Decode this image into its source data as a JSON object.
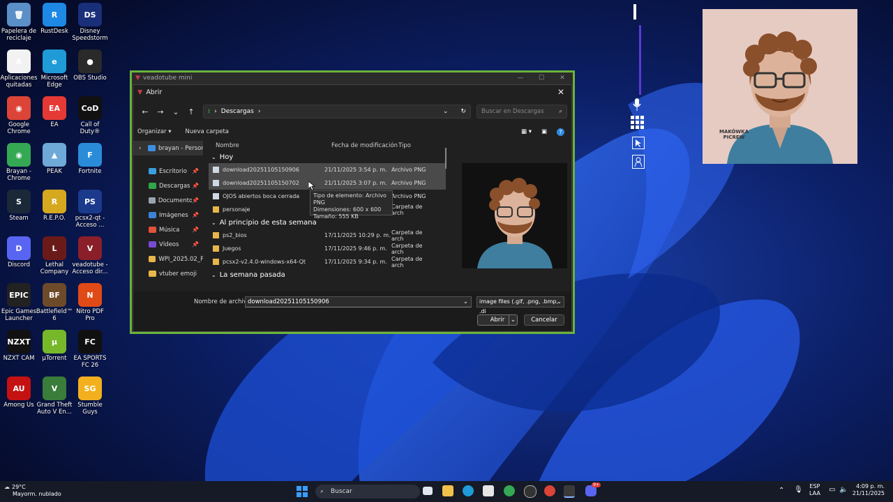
{
  "desktop": {
    "icons": [
      {
        "label": "Papelera de reciclaje",
        "color": "#5a8fc7",
        "glyph": "🗑"
      },
      {
        "label": "RustDesk",
        "color": "#1e88e5",
        "glyph": "R"
      },
      {
        "label": "Disney Speedstorm",
        "color": "#1a2f7a",
        "glyph": "DS"
      },
      {
        "label": "Aplicaciones quitadas",
        "color": "#f2f2f2",
        "glyph": "A"
      },
      {
        "label": "Microsoft Edge",
        "color": "#1f9bd7",
        "glyph": "e"
      },
      {
        "label": "OBS Studio",
        "color": "#2a2a2a",
        "glyph": "●"
      },
      {
        "label": "Google Chrome",
        "color": "#db4437",
        "glyph": "◉"
      },
      {
        "label": "EA",
        "color": "#e53935",
        "glyph": "EA"
      },
      {
        "label": "Call of Duty®",
        "color": "#111111",
        "glyph": "CoD"
      },
      {
        "label": "Brayan - Chrome",
        "color": "#34a853",
        "glyph": "◉"
      },
      {
        "label": "PEAK",
        "color": "#6ea9d8",
        "glyph": "▲"
      },
      {
        "label": "Fortnite",
        "color": "#2a8cd8",
        "glyph": "F"
      },
      {
        "label": "Steam",
        "color": "#1b2838",
        "glyph": "S"
      },
      {
        "label": "R.E.P.O.",
        "color": "#d6a820",
        "glyph": "R"
      },
      {
        "label": "pcsx2-qt - Acceso ...",
        "color": "#1b3a8c",
        "glyph": "PS"
      },
      {
        "label": "Discord",
        "color": "#5865f2",
        "glyph": "D"
      },
      {
        "label": "Lethal Company",
        "color": "#6b1a1a",
        "glyph": "L"
      },
      {
        "label": "veadotube - Acceso dir...",
        "color": "#8a1f2a",
        "glyph": "V"
      },
      {
        "label": "Epic Games Launcher",
        "color": "#222222",
        "glyph": "EPIC"
      },
      {
        "label": "Battlefield™ 6",
        "color": "#6d4a2a",
        "glyph": "BF"
      },
      {
        "label": "Nitro PDF Pro",
        "color": "#e04a16",
        "glyph": "N"
      },
      {
        "label": "NZXT CAM",
        "color": "#111111",
        "glyph": "NZXT"
      },
      {
        "label": "µTorrent",
        "color": "#77b82a",
        "glyph": "µ"
      },
      {
        "label": "EA SPORTS FC 26",
        "color": "#101010",
        "glyph": "FC"
      },
      {
        "label": "Among Us",
        "color": "#c51111",
        "glyph": "AU"
      },
      {
        "label": "Grand Theft Auto V En...",
        "color": "#3a7d3a",
        "glyph": "V"
      },
      {
        "label": "Stumble Guys",
        "color": "#f2b01e",
        "glyph": "SG"
      }
    ]
  },
  "vt_window": {
    "title": "veadotube mini"
  },
  "dialog": {
    "title": "Abrir",
    "breadcrumb": "Descargas",
    "search_placeholder": "Buscar en Descargas",
    "organize": "Organizar",
    "new_folder": "Nueva carpeta",
    "nav": [
      {
        "label": "brayan - Person",
        "color": "#3b8fe0"
      },
      {
        "label": "Escritorio",
        "color": "#3b9ee0"
      },
      {
        "label": "Descargas",
        "color": "#2fa64a"
      },
      {
        "label": "Documentos",
        "color": "#9aa4b0"
      },
      {
        "label": "Imágenes",
        "color": "#3a84d6"
      },
      {
        "label": "Música",
        "color": "#e0523b"
      },
      {
        "label": "Vídeos",
        "color": "#7a4ad6"
      },
      {
        "label": "WPI_2025.02_Pl",
        "color": "#e8b64a"
      },
      {
        "label": "vtuber emoji",
        "color": "#e8b64a"
      }
    ],
    "columns": {
      "name": "Nombre",
      "date": "Fecha de modificación",
      "type": "Tipo"
    },
    "groups": [
      {
        "label": "Hoy",
        "rows": [
          {
            "name": "download20251105150906",
            "date": "21/11/2025 3:54 p. m.",
            "type": "Archivo PNG",
            "kind": "file",
            "selected": true
          },
          {
            "name": "download20251105150702",
            "date": "21/11/2025 3:07 p. m.",
            "type": "Archivo PNG",
            "kind": "file",
            "selected": true
          },
          {
            "name": "OJOS abiertos boca cerrada",
            "date": "",
            "type": "Archivo PNG",
            "kind": "file",
            "selected": false
          },
          {
            "name": "personaje",
            "date": "",
            "type": "Carpeta de arch",
            "kind": "folder",
            "selected": false
          }
        ]
      },
      {
        "label": "Al principio de esta semana",
        "rows": [
          {
            "name": "ps2_bios",
            "date": "17/11/2025 10:29 p. m.",
            "type": "Carpeta de arch",
            "kind": "folder",
            "selected": false
          },
          {
            "name": "Juegos",
            "date": "17/11/2025 9:46 p. m.",
            "type": "Carpeta de arch",
            "kind": "folder",
            "selected": false
          },
          {
            "name": "pcsx2-v2.4.0-windows-x64-Qt",
            "date": "17/11/2025 9:34 p. m.",
            "type": "Carpeta de arch",
            "kind": "folder",
            "selected": false
          }
        ]
      },
      {
        "label": "La semana pasada",
        "rows": []
      }
    ],
    "tooltip": {
      "type": "Tipo de elemento: Archivo PNG",
      "dims": "Dimensiones: 600 x 600",
      "size": "Tamaño: 555 KB"
    },
    "filename_label": "Nombre de archivo:",
    "filename_value": "download20251105150906",
    "filetype_value": "image files (.gif, .png, .bmp, .di",
    "open_label": "Abrir",
    "cancel_label": "Cancelar"
  },
  "avatar": {
    "watermark": "MAKÓWKA PICREW"
  },
  "taskbar": {
    "temp": "29°C",
    "weather": "Mayorm. nublado",
    "search": "Buscar",
    "lang": "ESP",
    "lang2": "LAA",
    "time": "4:09 p. m.",
    "date": "21/11/2025",
    "badge": "9+"
  }
}
